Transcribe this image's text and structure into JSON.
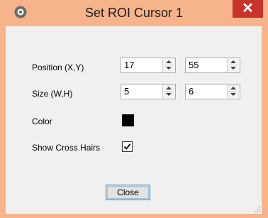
{
  "window": {
    "title": "Set ROI Cursor 1",
    "close_glyph": "✕",
    "icon": "ring-icon"
  },
  "form": {
    "position": {
      "label": "Position (X,Y)",
      "x": "17",
      "y": "55"
    },
    "size": {
      "label": "Size (W,H)",
      "w": "5",
      "h": "6"
    },
    "color": {
      "label": "Color",
      "value": "#000000"
    },
    "crosshairs": {
      "label": "Show Cross Hairs",
      "checked": true
    }
  },
  "buttons": {
    "close_label": "Close"
  },
  "colors": {
    "title_bar": "#f7b48c",
    "close_button": "#c7342b",
    "client": "#f0f0f0"
  }
}
